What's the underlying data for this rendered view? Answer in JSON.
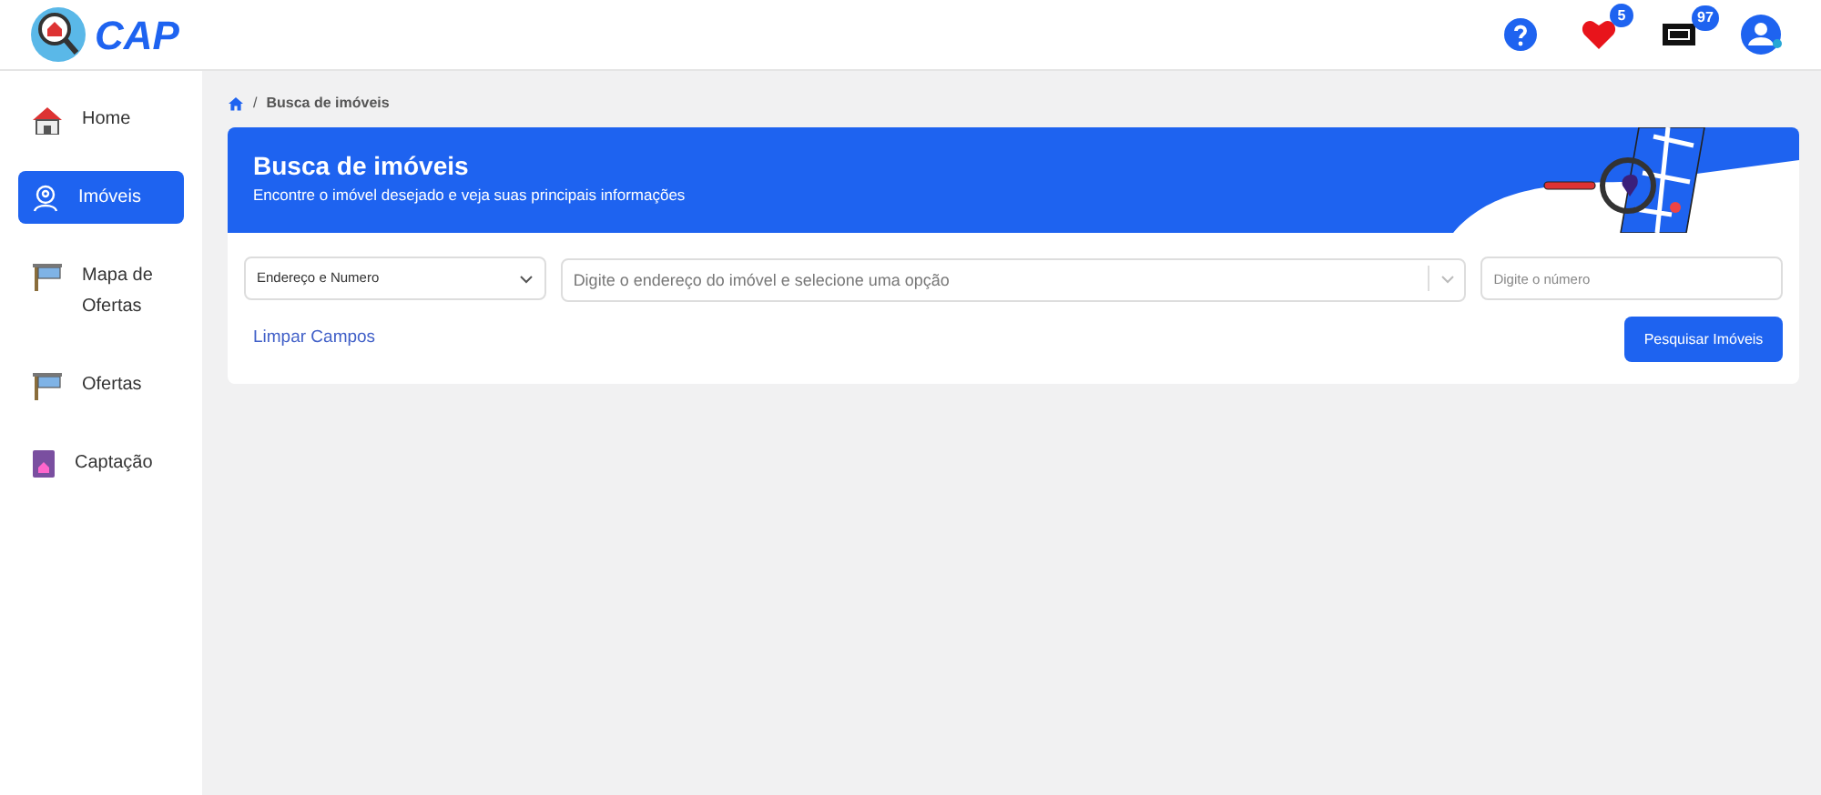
{
  "header": {
    "logo_text": "CAP",
    "favorites_count": "5",
    "tickets_count": "97"
  },
  "sidebar": {
    "items": [
      {
        "label": "Home",
        "kind": "home",
        "selected": false
      },
      {
        "label": "Imóveis",
        "kind": "property",
        "selected": true
      },
      {
        "label": "Mapa de Ofertas",
        "kind": "sign",
        "selected": false
      },
      {
        "label": "Ofertas",
        "kind": "sign",
        "selected": false
      },
      {
        "label": "Captação",
        "kind": "notebook",
        "selected": false
      }
    ]
  },
  "breadcrumb": {
    "separator": "/",
    "current": "Busca de imóveis"
  },
  "banner": {
    "title": "Busca de imóveis",
    "subtitle": "Encontre o imóvel desejado e veja suas principais informações"
  },
  "form": {
    "search_type": "Endereço e Numero",
    "address_placeholder": "Digite o endereço do imóvel e selecione uma opção",
    "number_placeholder": "Digite o número",
    "clear_link": "Limpar Campos",
    "search_button": "Pesquisar Imóveis"
  }
}
